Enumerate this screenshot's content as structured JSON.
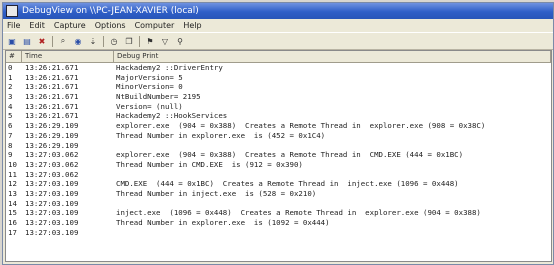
{
  "window": {
    "title": "DebugView on \\\\PC-JEAN-XAVIER (local)"
  },
  "menu": [
    "File",
    "Edit",
    "Capture",
    "Options",
    "Computer",
    "Help"
  ],
  "toolbar": {
    "icons": [
      "open-icon",
      "save-icon",
      "clear-icon",
      "find-icon",
      "capture-icon",
      "autoscroll-icon",
      "clock-icon",
      "copy-icon",
      "highlight-icon",
      "filter-icon",
      "binoculars-icon"
    ]
  },
  "columns": {
    "num": "#",
    "time": "Time",
    "print": "Debug Print"
  },
  "rows": [
    {
      "n": "0",
      "t": "13:26:21.671",
      "p": "Hackademy2 ::DriverEntry"
    },
    {
      "n": "1",
      "t": "13:26:21.671",
      "p": "MajorVersion= 5"
    },
    {
      "n": "2",
      "t": "13:26:21.671",
      "p": "MinorVersion= 0"
    },
    {
      "n": "3",
      "t": "13:26:21.671",
      "p": "NtBuildNumber= 2195"
    },
    {
      "n": "4",
      "t": "13:26:21.671",
      "p": "Version= (null)"
    },
    {
      "n": "5",
      "t": "13:26:21.671",
      "p": "Hackademy2 ::HookServices"
    },
    {
      "n": "6",
      "t": "13:26:29.109",
      "p": "explorer.exe  (904 = 0x388)  Creates a Remote Thread in  explorer.exe (908 = 0x38C)"
    },
    {
      "n": "7",
      "t": "13:26:29.109",
      "p": "Thread Number in explorer.exe  is (452 = 0x1C4)"
    },
    {
      "n": "8",
      "t": "13:26:29.109",
      "p": ""
    },
    {
      "n": "9",
      "t": "13:27:03.062",
      "p": "explorer.exe  (904 = 0x388)  Creates a Remote Thread in  CMD.EXE (444 = 0x1BC)"
    },
    {
      "n": "10",
      "t": "13:27:03.062",
      "p": "Thread Number in CMD.EXE  is (912 = 0x390)"
    },
    {
      "n": "11",
      "t": "13:27:03.062",
      "p": ""
    },
    {
      "n": "12",
      "t": "13:27:03.109",
      "p": "CMD.EXE  (444 = 0x1BC)  Creates a Remote Thread in  inject.exe (1096 = 0x448)"
    },
    {
      "n": "13",
      "t": "13:27:03.109",
      "p": "Thread Number in inject.exe  is (528 = 0x210)"
    },
    {
      "n": "14",
      "t": "13:27:03.109",
      "p": ""
    },
    {
      "n": "15",
      "t": "13:27:03.109",
      "p": "inject.exe  (1096 = 0x448)  Creates a Remote Thread in  explorer.exe (904 = 0x388)"
    },
    {
      "n": "16",
      "t": "13:27:03.109",
      "p": "Thread Number in explorer.exe  is (1092 = 0x444)"
    },
    {
      "n": "17",
      "t": "13:27:03.109",
      "p": ""
    }
  ]
}
